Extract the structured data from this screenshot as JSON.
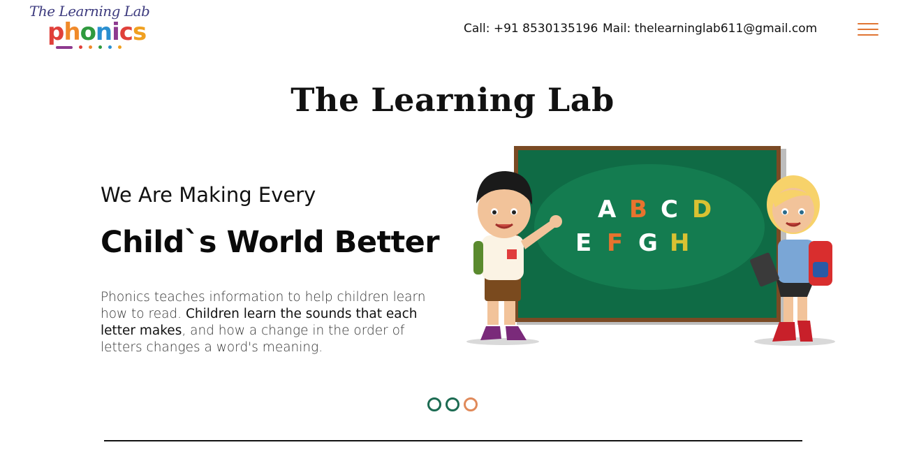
{
  "header": {
    "logo_top": "The Learning Lab",
    "logo_word": [
      "p",
      "h",
      "o",
      "n",
      "i",
      "c",
      "s"
    ],
    "logo_colors": [
      "#e0403a",
      "#f08a2a",
      "#2f9a3e",
      "#2a8fd0",
      "#8e3a8f",
      "#e0403a",
      "#f0a020"
    ],
    "call": "Call: +91 8530135196",
    "mail": "Mail: thelearninglab611@gmail.com",
    "menu_icon": "hamburger-menu-icon"
  },
  "hero": {
    "title": "The Learning Lab",
    "subtitle": "We Are Making Every",
    "headline": "Child`s World Better",
    "body_part1": "Phonics teaches information to help children learn how to read. ",
    "body_bold": "Children learn the sounds that each letter makes",
    "body_part2": ", and how a change in the order of letters changes a word's meaning."
  },
  "board": {
    "row1": [
      "A",
      "B",
      "C",
      "D"
    ],
    "row2": [
      "E",
      "F",
      "G",
      "H"
    ],
    "letter_colors": [
      "#ffffff",
      "#e8732e",
      "#ffffff",
      "#d9c232"
    ],
    "board_color": "#0f6b45",
    "frame_color": "#7a4a24"
  },
  "slider": {
    "count": 3,
    "active_index": 2,
    "colors": {
      "inactive": "#1c6b52",
      "active": "#e08a5a"
    }
  }
}
